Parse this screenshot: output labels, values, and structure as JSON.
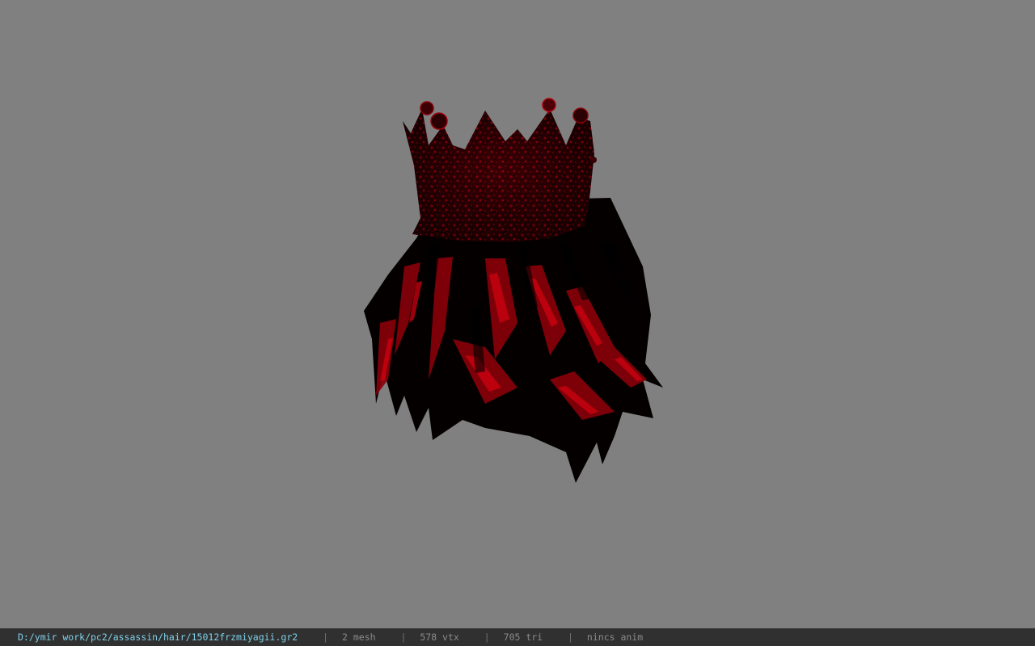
{
  "viewport": {
    "background_color": "#808080",
    "model_colors": {
      "base": "#0a0000",
      "highlight": "#c4000a",
      "mid": "#6a0006"
    }
  },
  "status_bar": {
    "file_path": "D:/ymir work/pc2/assassin/hair/15012frzmiyagii.gr2",
    "separator": "|",
    "mesh_count": "2 mesh",
    "vertex_count": "578 vtx",
    "triangle_count": "705 tri",
    "animation": "nincs anim",
    "path_color": "#7fd0e8",
    "background_color": "#303030"
  }
}
